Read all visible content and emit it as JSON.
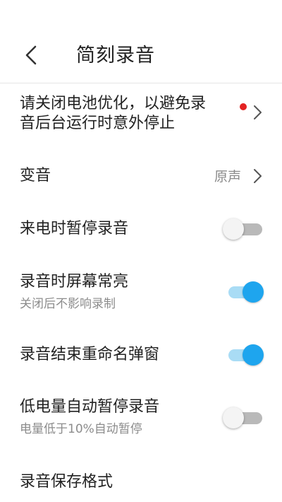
{
  "header": {
    "title": "简刻录音",
    "back_icon": "chevron-left-icon"
  },
  "settings": {
    "battery": {
      "title_line1": "请关闭电池优化，以避免录",
      "title_line2": "音后台运行时意外停止",
      "badge_color": "#e32222"
    },
    "voice_change": {
      "title": "变音",
      "value": "原声"
    },
    "pause_on_call": {
      "title": "来电时暂停录音",
      "enabled": false
    },
    "screen_on": {
      "title": "录音时屏幕常亮",
      "subtitle": "关闭后不影响录制",
      "enabled": true
    },
    "rename_popup": {
      "title": "录音结束重命名弹窗",
      "enabled": true
    },
    "low_battery_pause": {
      "title": "低电量自动暂停录音",
      "subtitle": "电量低于10%自动暂停",
      "enabled": false
    },
    "save_format": {
      "title": "录音保存格式"
    }
  },
  "colors": {
    "accent": "#1ea5ee",
    "accent_track": "#a9dcf5",
    "toggle_off_track": "#b9b9b9",
    "secondary_text": "#8c8c8c"
  }
}
